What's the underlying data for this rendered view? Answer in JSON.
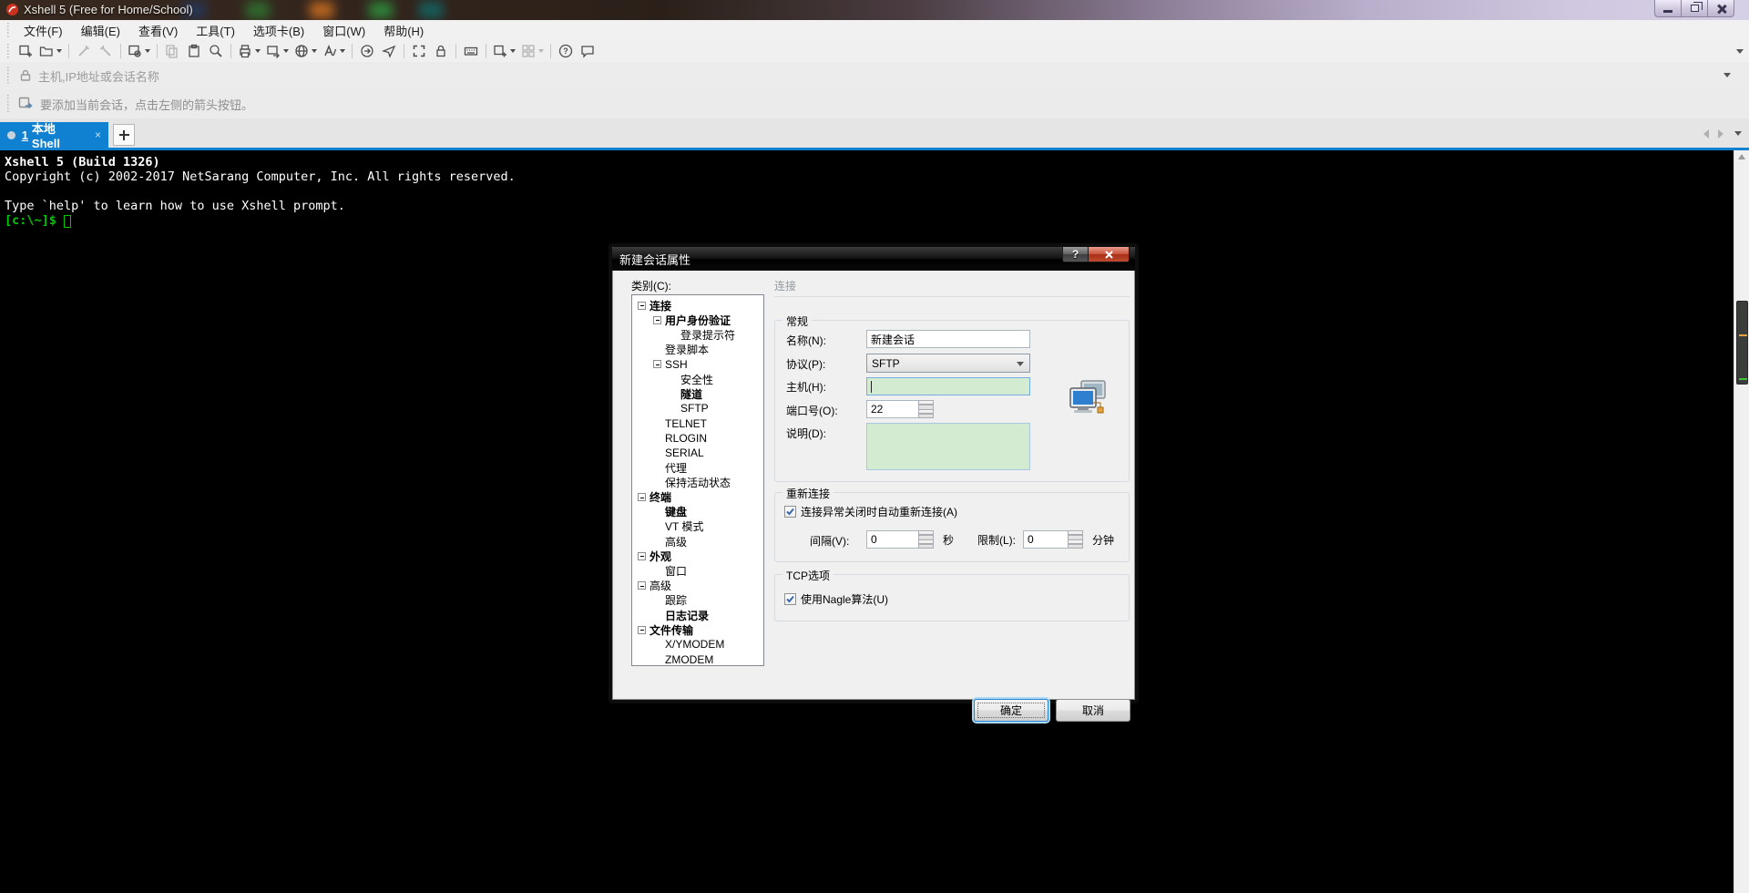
{
  "window": {
    "title": "Xshell 5 (Free for Home/School)"
  },
  "menu": {
    "items": [
      "文件(F)",
      "编辑(E)",
      "查看(V)",
      "工具(T)",
      "选项卡(B)",
      "窗口(W)",
      "帮助(H)"
    ]
  },
  "toolbar": {
    "items": [
      {
        "name": "new-session"
      },
      {
        "name": "open-session",
        "dropdown": true
      },
      {
        "sep": true
      },
      {
        "name": "disconnect",
        "disabled": true
      },
      {
        "name": "reconnect",
        "disabled": true
      },
      {
        "sep": true
      },
      {
        "name": "session-properties",
        "dropdown": true
      },
      {
        "sep": true
      },
      {
        "name": "copy",
        "disabled": true
      },
      {
        "name": "paste"
      },
      {
        "name": "find"
      },
      {
        "sep": true
      },
      {
        "name": "print",
        "dropdown": true
      },
      {
        "name": "transfer",
        "dropdown": true
      },
      {
        "name": "encoding",
        "dropdown": true
      },
      {
        "name": "font",
        "dropdown": true
      },
      {
        "sep": true
      },
      {
        "name": "xftp"
      },
      {
        "name": "xagent"
      },
      {
        "sep": true
      },
      {
        "name": "fullscreen"
      },
      {
        "name": "lock-screen"
      },
      {
        "sep": true
      },
      {
        "name": "keyboard"
      },
      {
        "sep": true
      },
      {
        "name": "new-tab",
        "dropdown": true
      },
      {
        "name": "tile-windows",
        "disabled": true,
        "dropdown": true
      },
      {
        "sep": true
      },
      {
        "name": "help"
      },
      {
        "name": "feedback"
      }
    ]
  },
  "address_bar": {
    "placeholder": "主机,IP地址或会话名称"
  },
  "session_bar": {
    "hint": "要添加当前会话，点击左侧的箭头按钮。"
  },
  "tabs": {
    "active": {
      "number": "1",
      "title": "本地Shell",
      "close": "×"
    }
  },
  "terminal": {
    "lines": [
      {
        "text": "Xshell 5 (Build 1326)",
        "bold": true,
        "color": "#ffffff"
      },
      {
        "text": "Copyright (c) 2002-2017 NetSarang Computer, Inc. All rights reserved.",
        "color": "#ffffff"
      },
      {
        "text": ""
      },
      {
        "text": "Type `help' to learn how to use Xshell prompt.",
        "color": "#ffffff"
      },
      {
        "text": "[c:\\~]$ ",
        "color": "#00c800",
        "bold": true,
        "cursor": true
      }
    ]
  },
  "dialog": {
    "title": "新建会话属性",
    "help_button": "?",
    "category_label": "类别(C):",
    "tree": [
      {
        "label": "连接",
        "level": 0,
        "expand": true,
        "bold": true
      },
      {
        "label": "用户身份验证",
        "level": 1,
        "expand": true,
        "bold": true
      },
      {
        "label": "登录提示符",
        "level": 2
      },
      {
        "label": "登录脚本",
        "level": 1
      },
      {
        "label": "SSH",
        "level": 1,
        "expand": true
      },
      {
        "label": "安全性",
        "level": 2
      },
      {
        "label": "隧道",
        "level": 2,
        "bold": true
      },
      {
        "label": "SFTP",
        "level": 2
      },
      {
        "label": "TELNET",
        "level": 1
      },
      {
        "label": "RLOGIN",
        "level": 1
      },
      {
        "label": "SERIAL",
        "level": 1
      },
      {
        "label": "代理",
        "level": 1
      },
      {
        "label": "保持活动状态",
        "level": 1
      },
      {
        "label": "终端",
        "level": 0,
        "expand": true,
        "bold": true
      },
      {
        "label": "键盘",
        "level": 1,
        "bold": true
      },
      {
        "label": "VT 模式",
        "level": 1
      },
      {
        "label": "高级",
        "level": 1
      },
      {
        "label": "外观",
        "level": 0,
        "expand": true,
        "bold": true
      },
      {
        "label": "窗口",
        "level": 1
      },
      {
        "label": "高级",
        "level": 0,
        "expand": true
      },
      {
        "label": "跟踪",
        "level": 1
      },
      {
        "label": "日志记录",
        "level": 1,
        "bold": true
      },
      {
        "label": "文件传输",
        "level": 0,
        "expand": true,
        "bold": true
      },
      {
        "label": "X/YMODEM",
        "level": 1
      },
      {
        "label": "ZMODEM",
        "level": 1
      }
    ],
    "panel": {
      "header": "连接",
      "general": {
        "legend": "常规",
        "name_label": "名称(N):",
        "name_value": "新建会话",
        "protocol_label": "协议(P):",
        "protocol_value": "SFTP",
        "host_label": "主机(H):",
        "host_value": "",
        "port_label": "端口号(O):",
        "port_value": "22",
        "desc_label": "说明(D):",
        "desc_value": ""
      },
      "reconnect": {
        "legend": "重新连接",
        "checkbox_label": "连接异常关闭时自动重新连接(A)",
        "checked": true,
        "interval_label": "间隔(V):",
        "interval_value": "0",
        "interval_unit": "秒",
        "limit_label": "限制(L):",
        "limit_value": "0",
        "limit_unit": "分钟"
      },
      "tcp": {
        "legend": "TCP选项",
        "checkbox_label": "使用Nagle算法(U)",
        "checked": true
      }
    },
    "buttons": {
      "ok": "确定",
      "cancel": "取消"
    }
  },
  "colors": {
    "tab_active": "#1081d1",
    "terminal_prompt": "#00c800",
    "field_hint_green": "#d3ecd1",
    "dialog_close_red": "#c04b2e"
  }
}
